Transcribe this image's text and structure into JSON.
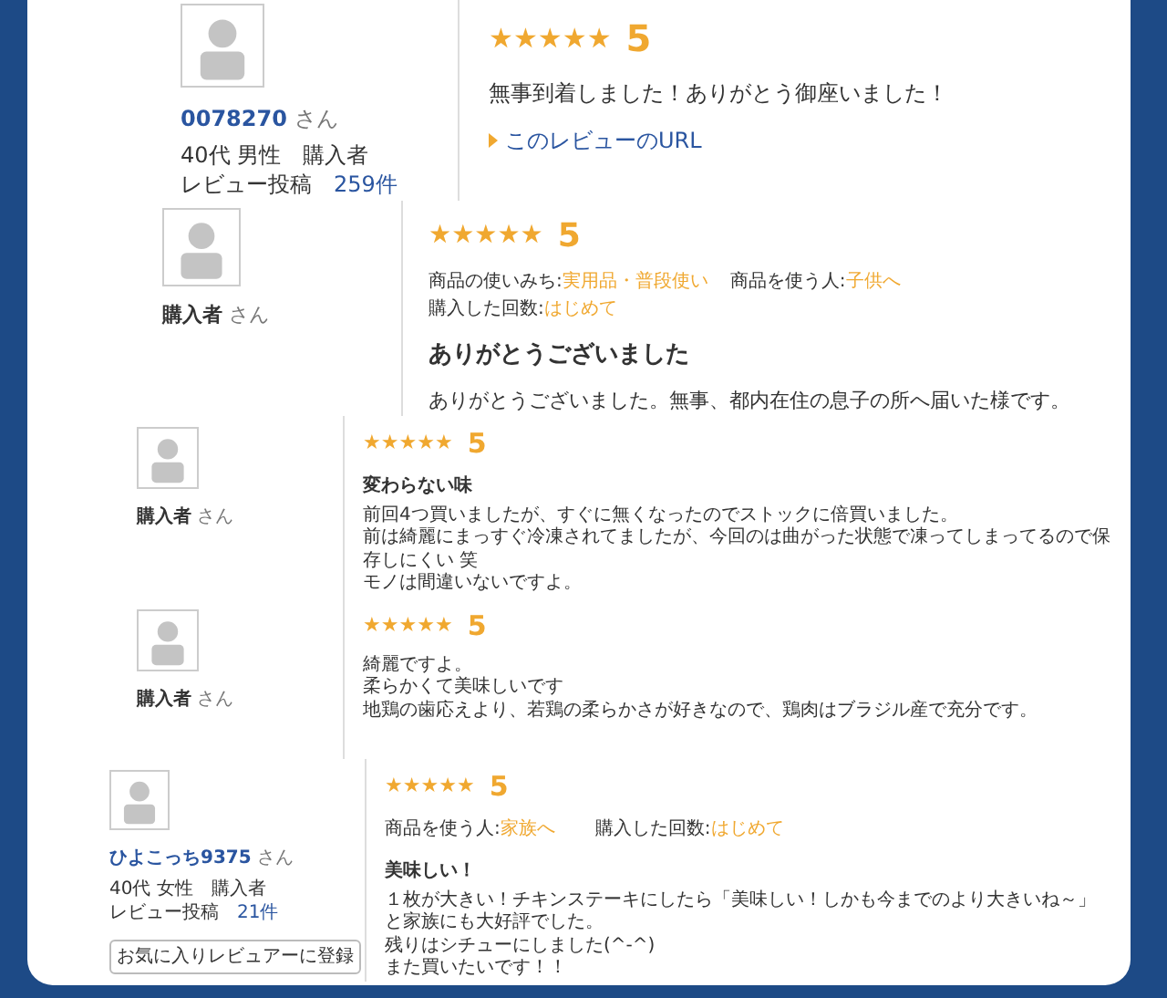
{
  "reviews": [
    {
      "reviewer": {
        "name": "0078270",
        "linked": true,
        "suffix": "さん",
        "profile": "40代 男性　購入者",
        "posts_label": "レビュー投稿",
        "posts_count": "259件"
      },
      "rating": {
        "stars": 5,
        "score": "5"
      },
      "body": [
        "無事到着しました！ありがとう御座いました！"
      ],
      "link": "このレビューのURL"
    },
    {
      "reviewer": {
        "name": "購入者",
        "linked": false,
        "suffix": "さん"
      },
      "rating": {
        "stars": 5,
        "score": "5"
      },
      "usage": [
        {
          "label": "商品の使いみち:",
          "value": "実用品・普段使い"
        },
        {
          "label": "商品を使う人:",
          "value": "子供へ"
        },
        {
          "label": "購入した回数:",
          "value": "はじめて"
        }
      ],
      "title": "ありがとうございました",
      "body": [
        "ありがとうございました。無事、都内在住の息子の所へ届いた様です。"
      ]
    },
    {
      "reviewer": {
        "name": "購入者",
        "linked": false,
        "suffix": "さん"
      },
      "rating": {
        "stars": 5,
        "score": "5"
      },
      "title": "変わらない味",
      "body": [
        "前回4つ買いましたが、すぐに無くなったのでストックに倍買いました。",
        "前は綺麗にまっすぐ冷凍されてましたが、今回のは曲がった状態で凍ってしまってるので保存しにくい 笑",
        "モノは間違いないですよ。"
      ]
    },
    {
      "reviewer": {
        "name": "購入者",
        "linked": false,
        "suffix": "さん"
      },
      "rating": {
        "stars": 5,
        "score": "5"
      },
      "body": [
        "綺麗ですよ。",
        "柔らかくて美味しいです",
        "地鶏の歯応えより、若鶏の柔らかさが好きなので、鶏肉はブラジル産で充分です。"
      ]
    },
    {
      "reviewer": {
        "name": "ひよこっち9375",
        "linked": true,
        "suffix": "さん",
        "profile": "40代 女性　購入者",
        "posts_label": "レビュー投稿",
        "posts_count": "21件",
        "button": "お気に入りレビュアーに登録"
      },
      "rating": {
        "stars": 5,
        "score": "5"
      },
      "usage": [
        {
          "label": "商品を使う人:",
          "value": "家族へ"
        },
        {
          "label": "購入した回数:",
          "value": "はじめて"
        }
      ],
      "title": "美味しい！",
      "body": [
        "１枚が大きい！チキンステーキにしたら「美味しい！しかも今までのより大きいね～」と家族にも大好評でした。",
        "残りはシチューにしました(^-^)",
        "また買いたいです！！"
      ]
    }
  ]
}
